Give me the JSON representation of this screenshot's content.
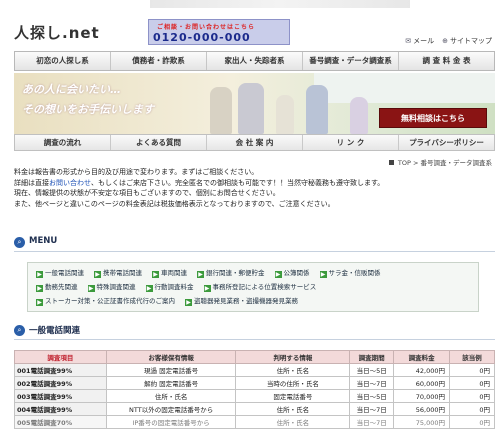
{
  "header": {
    "logo": "人探し.net",
    "banner_small": "ご相談・お問い合わせはこちら",
    "banner_number": "0120-000-000",
    "links": [
      {
        "icon": "mail-icon",
        "label": "メール"
      },
      {
        "icon": "sitemap-icon",
        "label": "サイトマップ"
      }
    ]
  },
  "nav": {
    "items": [
      "初恋の人探し系",
      "債務者・詐欺系",
      "家出人・失踪者系",
      "番号調査・データ調査系",
      "調 査 料 金 表"
    ]
  },
  "hero": {
    "line1": "あの人に会いたい…",
    "line2": "その想いをお手伝いします",
    "cta": "無料相談はこちら"
  },
  "subnav": {
    "items": [
      "調査の流れ",
      "よくある質問",
      "会 社 案 内",
      "リ ン ク",
      "プライバシーポリシー"
    ]
  },
  "breadcrumb": {
    "home": "TOP",
    "current": "番号調査・データ調査系"
  },
  "intro": {
    "line1": "料金は報告書の形式から目的及び用途で変わります。まずはご相談ください。",
    "line2_a": "詳細は直接",
    "line2_link": "お問い合わせ",
    "line2_b": "、もしくはご来店下さい。完全匿名での御相談も可能です！！当然守秘義務も遵守致します。",
    "line3": "現在、情報提供の状態が不安定な項目もございますので、個別にお問合せください。",
    "line4": "また、他ページと違いこのページの料金表記は税抜価格表示となっておりますので、ご注意ください。"
  },
  "menu": {
    "title": "MENU",
    "rows": [
      [
        "一般電話関連",
        "携帯電話関連",
        "車両関連",
        "銀行関連・郵便貯金",
        "公簿関係",
        "サラ金・信販関係"
      ],
      [
        "勤務先関連",
        "特殊調査関連",
        "行動調査料金",
        "事務所登記による位置検索サービス"
      ],
      [
        "ストーカー対策・公正証書作成代行のご案内",
        "盗聴器発見業務・盗撮機器発見業務"
      ]
    ]
  },
  "section2": {
    "title": "一般電話関連"
  },
  "table": {
    "headers": [
      "調査項目",
      "お客様保有情報",
      "判明する情報",
      "調査期間",
      "調査料金",
      "該当例"
    ],
    "rows": [
      [
        "001電話調査99%",
        "現過 固定電話番号",
        "住所・氏名",
        "当日～5日",
        "42,000円",
        "0円"
      ],
      [
        "002電話調査99%",
        "解約 固定電話番号",
        "当時の住所・氏名",
        "当日～7日",
        "60,000円",
        "0円"
      ],
      [
        "003電話調査99%",
        "住所・氏名",
        "固定電話番号",
        "当日～5日",
        "70,000円",
        "0円"
      ],
      [
        "004電話調査99%",
        "NTT以外の固定電話番号から",
        "住所・氏名",
        "当日～7日",
        "56,000円",
        "0円"
      ],
      [
        "005電話調査70%",
        "IP番号の固定電話番号から",
        "住所・氏名",
        "当日～7日",
        "75,000円",
        "0円"
      ]
    ]
  }
}
